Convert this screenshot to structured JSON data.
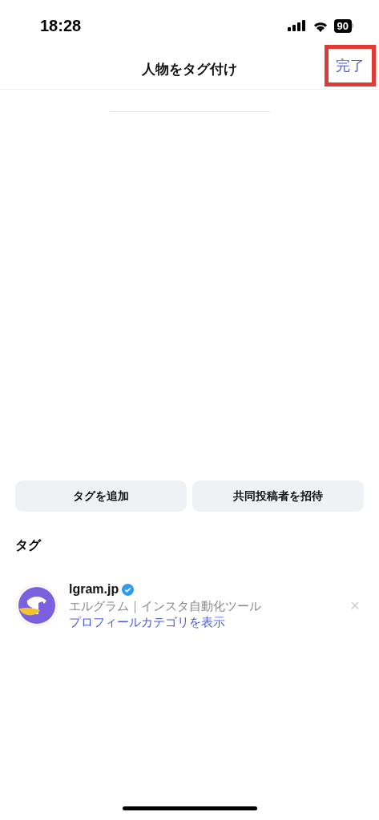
{
  "status_bar": {
    "time": "18:28",
    "battery": "90"
  },
  "nav": {
    "title": "人物をタグ付け",
    "done": "完了",
    "done_highlighted": true
  },
  "actions": [
    {
      "label": "タグを追加"
    },
    {
      "label": "共同投稿者を招待"
    }
  ],
  "section_title": "タグ",
  "tags": [
    {
      "username": "lgram.jp",
      "verified": true,
      "full_name": "エルグラム｜インスタ自動化ツール",
      "link": "プロフィールカテゴリを表示",
      "remove": "×"
    }
  ]
}
